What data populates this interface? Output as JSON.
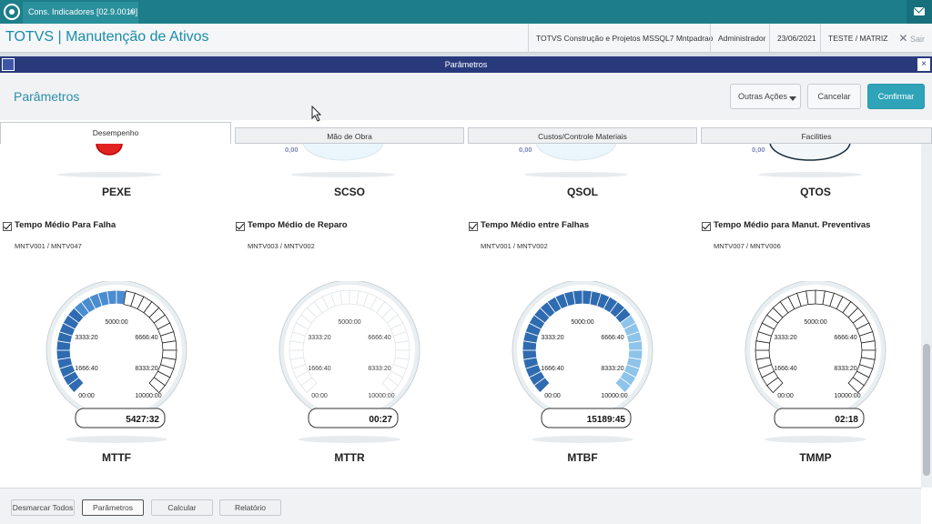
{
  "topbar": {
    "tab_label": "Cons. Indicadores [02.9.0019]",
    "tab_close": "×"
  },
  "header": {
    "title": "TOTVS | Manutenção de Ativos",
    "company": "TOTVS Construção e Projetos MSSQL7 Mntpadrao",
    "user": "Administrador",
    "date": "23/06/2021",
    "branch": "TESTE / MATRIZ",
    "exit_label": "Sair"
  },
  "dialog": {
    "window_title": "Parâmetros",
    "page_title": "Parâmetros",
    "close_glyph": "×",
    "actions": {
      "more": "Outras Ações",
      "cancel": "Cancelar",
      "confirm": "Confirmar"
    },
    "tabs": [
      "Desempenho",
      "Mão de Obra",
      "Custos/Controle Materiais",
      "Facilities"
    ]
  },
  "previous_row": [
    {
      "code": "PEXE",
      "zero": ""
    },
    {
      "code": "SCSO",
      "zero": "0,00"
    },
    {
      "code": "QSOL",
      "zero": "0,00"
    },
    {
      "code": "QTOS",
      "zero": "0,00"
    }
  ],
  "indicators": [
    {
      "title": "Tempo Médio Para Falha",
      "codes": "MNTV001 / MNTV047",
      "name": "MTTF",
      "value": "5427:32",
      "level": 0.5428,
      "checked": true,
      "shade": "dark"
    },
    {
      "title": "Tempo Médio de Reparo",
      "codes": "MNTV003 / MNTV002",
      "name": "MTTR",
      "value": "00:27",
      "level": 0.0,
      "checked": true,
      "shade": "none"
    },
    {
      "title": "Tempo Médio entre Falhas",
      "codes": "MNTV001 / MNTV002",
      "name": "MTBF",
      "value": "15189:45",
      "level": 1.0,
      "checked": true,
      "shade": "full"
    },
    {
      "title": "Tempo Médio para Manut. Preventivas",
      "codes": "MNTV007 / MNTV006",
      "name": "TMMP",
      "value": "02:18",
      "level": 0.0,
      "checked": true,
      "shade": "outline"
    }
  ],
  "gauge_ticks": [
    "00:00",
    "1666:40",
    "3333:20",
    "5000:00",
    "6666:40",
    "8333:20",
    "10000:00"
  ],
  "footer": {
    "uncheck_all": "Desmarcar Todos",
    "params": "Parâmetros",
    "calculate": "Calcular",
    "report": "Relatório"
  },
  "colors": {
    "brand": "#1d7e8a",
    "dialog_bar": "#283a7c",
    "accent": "#2fa3b8",
    "gauge_dark": "#2f6bb0",
    "gauge_light": "#8ec3ea"
  }
}
